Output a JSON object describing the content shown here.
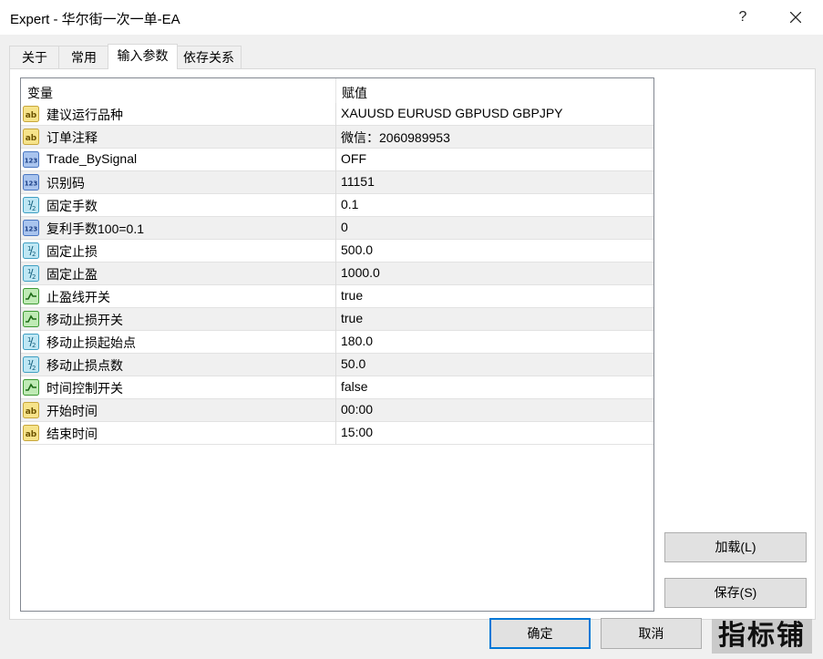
{
  "window": {
    "title": "Expert - 华尔街一次一单-EA",
    "help": "?"
  },
  "tabs": [
    {
      "label": "关于"
    },
    {
      "label": "常用"
    },
    {
      "label": "输入参数"
    },
    {
      "label": "依存关系"
    }
  ],
  "grid": {
    "columns": [
      "变量",
      "赋值"
    ],
    "rows": [
      {
        "type_icon": "string-icon",
        "name": "建议运行品种",
        "value": "XAUUSD EURUSD GBPUSD GBPJPY"
      },
      {
        "type_icon": "string-icon",
        "name": "订单注释",
        "value": "微信：2060989953"
      },
      {
        "type_icon": "integer-icon",
        "name": "Trade_BySignal",
        "value": "OFF"
      },
      {
        "type_icon": "integer-icon",
        "name": "识别码",
        "value": "11151"
      },
      {
        "type_icon": "double-icon",
        "name": "固定手数",
        "value": "0.1"
      },
      {
        "type_icon": "integer-icon",
        "name": "复利手数100=0.1",
        "value": "0"
      },
      {
        "type_icon": "double-icon",
        "name": "固定止损",
        "value": "500.0"
      },
      {
        "type_icon": "double-icon",
        "name": "固定止盈",
        "value": "1000.0"
      },
      {
        "type_icon": "bool-icon",
        "name": "止盈线开关",
        "value": "true"
      },
      {
        "type_icon": "bool-icon",
        "name": "移动止损开关",
        "value": "true"
      },
      {
        "type_icon": "double-icon",
        "name": "移动止损起始点",
        "value": "180.0"
      },
      {
        "type_icon": "double-icon",
        "name": "移动止损点数",
        "value": "50.0"
      },
      {
        "type_icon": "bool-icon",
        "name": "时间控制开关",
        "value": "false"
      },
      {
        "type_icon": "string-icon",
        "name": "开始时间",
        "value": "00:00"
      },
      {
        "type_icon": "string-icon",
        "name": "结束时间",
        "value": "15:00"
      }
    ]
  },
  "side_buttons": {
    "load": "加载(L)",
    "save": "保存(S)"
  },
  "footer": {
    "ok": "确定",
    "cancel": "取消"
  },
  "watermark": "指标铺",
  "colors": {
    "accent": "#0078d7",
    "alt_row": "#f0f0f0"
  }
}
